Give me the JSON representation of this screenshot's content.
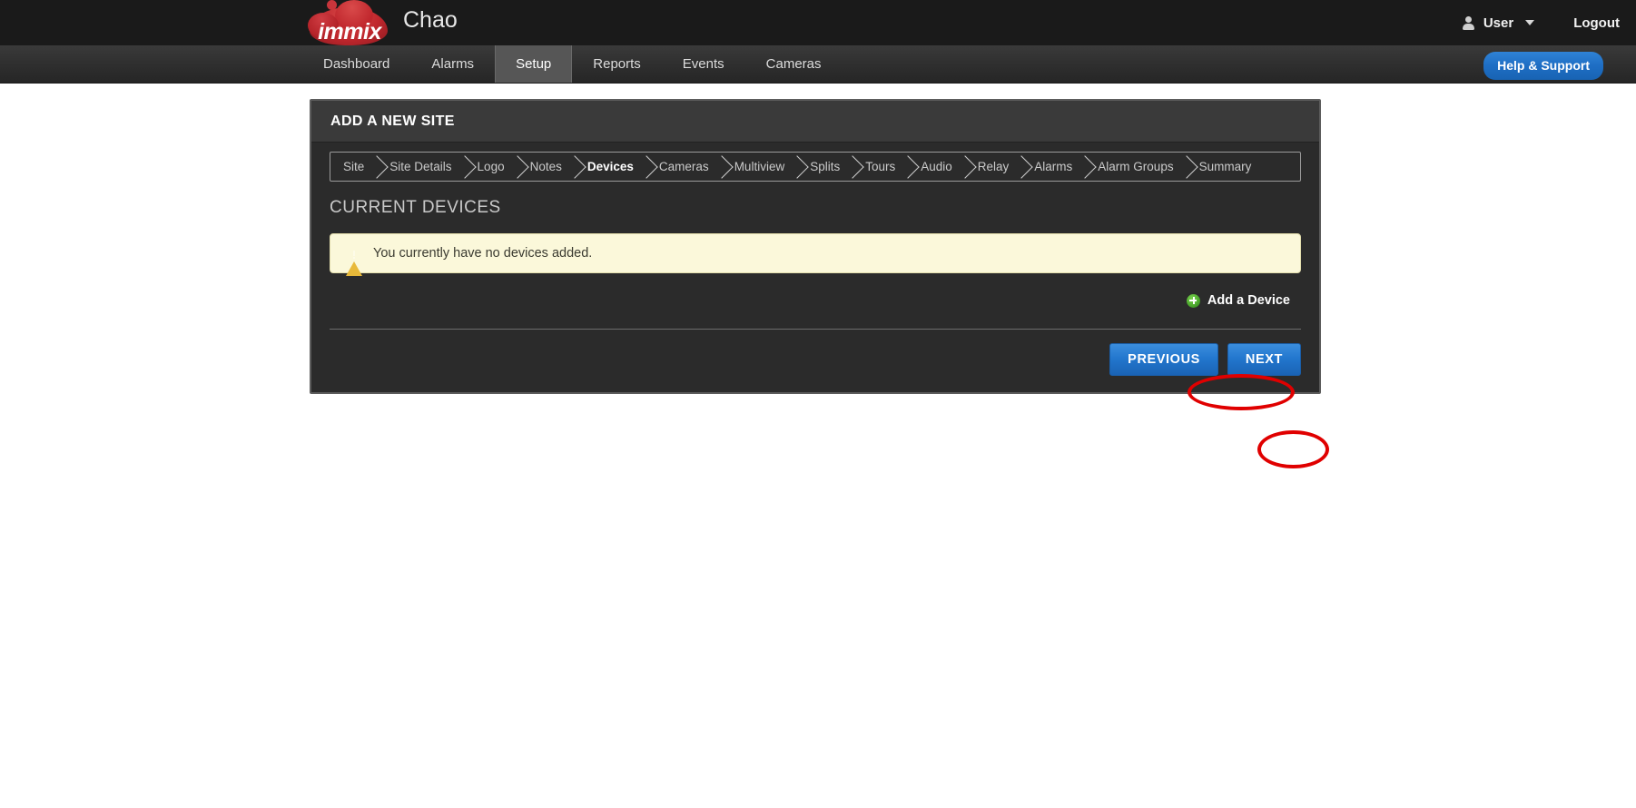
{
  "header": {
    "brand_word": "immix",
    "app_title": "Chao",
    "user_label": "User",
    "logout_label": "Logout",
    "person_icon": "person-icon",
    "caret_icon": "chevron-down-icon"
  },
  "nav": {
    "tabs": [
      {
        "label": "Dashboard",
        "active": false
      },
      {
        "label": "Alarms",
        "active": false
      },
      {
        "label": "Setup",
        "active": true
      },
      {
        "label": "Reports",
        "active": false
      },
      {
        "label": "Events",
        "active": false
      },
      {
        "label": "Cameras",
        "active": false
      }
    ],
    "help_label": "Help & Support"
  },
  "panel": {
    "title": "ADD A NEW SITE",
    "steps": [
      {
        "label": "Site",
        "active": false
      },
      {
        "label": "Site Details",
        "active": false
      },
      {
        "label": "Logo",
        "active": false
      },
      {
        "label": "Notes",
        "active": false
      },
      {
        "label": "Devices",
        "active": true
      },
      {
        "label": "Cameras",
        "active": false
      },
      {
        "label": "Multiview",
        "active": false
      },
      {
        "label": "Splits",
        "active": false
      },
      {
        "label": "Tours",
        "active": false
      },
      {
        "label": "Audio",
        "active": false
      },
      {
        "label": "Relay",
        "active": false
      },
      {
        "label": "Alarms",
        "active": false
      },
      {
        "label": "Alarm Groups",
        "active": false
      },
      {
        "label": "Summary",
        "active": false
      }
    ],
    "section_title": "CURRENT DEVICES",
    "alert": {
      "icon": "warning-triangle-icon",
      "message": "You currently have no devices added."
    },
    "add_device_label": "Add a Device",
    "add_device_icon": "plus-circle-icon",
    "previous_label": "PREVIOUS",
    "next_label": "NEXT"
  },
  "colors": {
    "accent_blue": "#2276cd",
    "warning_bg": "#fbf8da",
    "warning_icon": "#e8b93a",
    "add_icon_green": "#4aa62c",
    "annotation_red": "#e00000",
    "brand_red": "#c0272d"
  },
  "annotations": [
    {
      "target": "add-device-button",
      "shape": "ellipse",
      "color": "#e00000"
    },
    {
      "target": "next-button",
      "shape": "ellipse",
      "color": "#e00000"
    }
  ]
}
